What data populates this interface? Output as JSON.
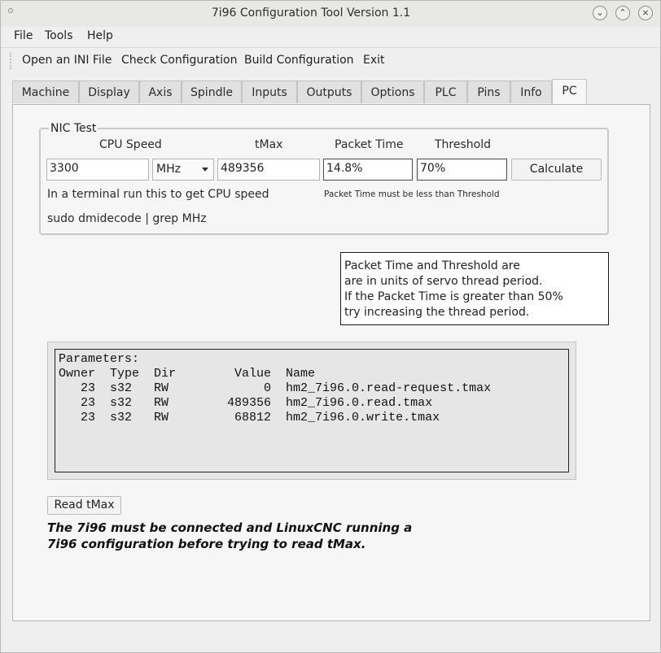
{
  "window": {
    "title": "7i96 Configuration Tool Version 1.1"
  },
  "menu": {
    "file": "File",
    "tools": "Tools",
    "help": "Help"
  },
  "toolbar": {
    "open_ini": "Open an INI File",
    "check": "Check Configuration",
    "build": "Build Configuration",
    "exit": "Exit"
  },
  "tabs": [
    "Machine",
    "Display",
    "Axis",
    "Spindle",
    "Inputs",
    "Outputs",
    "Options",
    "PLC",
    "Pins",
    "Info",
    "PC"
  ],
  "active_tab": "PC",
  "nic": {
    "title": "NIC Test",
    "cpu_speed_label": "CPU Speed",
    "tmax_label": "tMax",
    "packet_time_label": "Packet Time",
    "threshold_label": "Threshold",
    "cpu_speed_value": "3300",
    "unit_value": "MHz",
    "tmax_value": "489356",
    "packet_time_value": "14.8%",
    "threshold_value": "70%",
    "calculate_label": "Calculate",
    "terminal_hint": "In a terminal run this to get CPU speed",
    "packet_hint": "Packet Time must be less than Threshold",
    "command": "sudo dmidecode | grep MHz"
  },
  "note": {
    "line1": "Packet Time and Threshold are",
    "line2": "are in units of servo thread period.",
    "line3": "If the Packet Time is greater than 50%",
    "line4": "try increasing the thread period."
  },
  "params": {
    "heading": "Parameters:",
    "columns": [
      "Owner",
      "Type",
      "Dir",
      "Value",
      "Name"
    ],
    "rows": [
      [
        "23",
        "s32",
        "RW",
        "0",
        "hm2_7i96.0.read-request.tmax"
      ],
      [
        "23",
        "s32",
        "RW",
        "489356",
        "hm2_7i96.0.read.tmax"
      ],
      [
        "23",
        "s32",
        "RW",
        "68812",
        "hm2_7i96.0.write.tmax"
      ]
    ]
  },
  "read_tmax_label": "Read tMax",
  "warning": {
    "line1": "The 7i96 must be connected and LinuxCNC running a",
    "line2": "7i96 configuration before trying to read tMax."
  }
}
